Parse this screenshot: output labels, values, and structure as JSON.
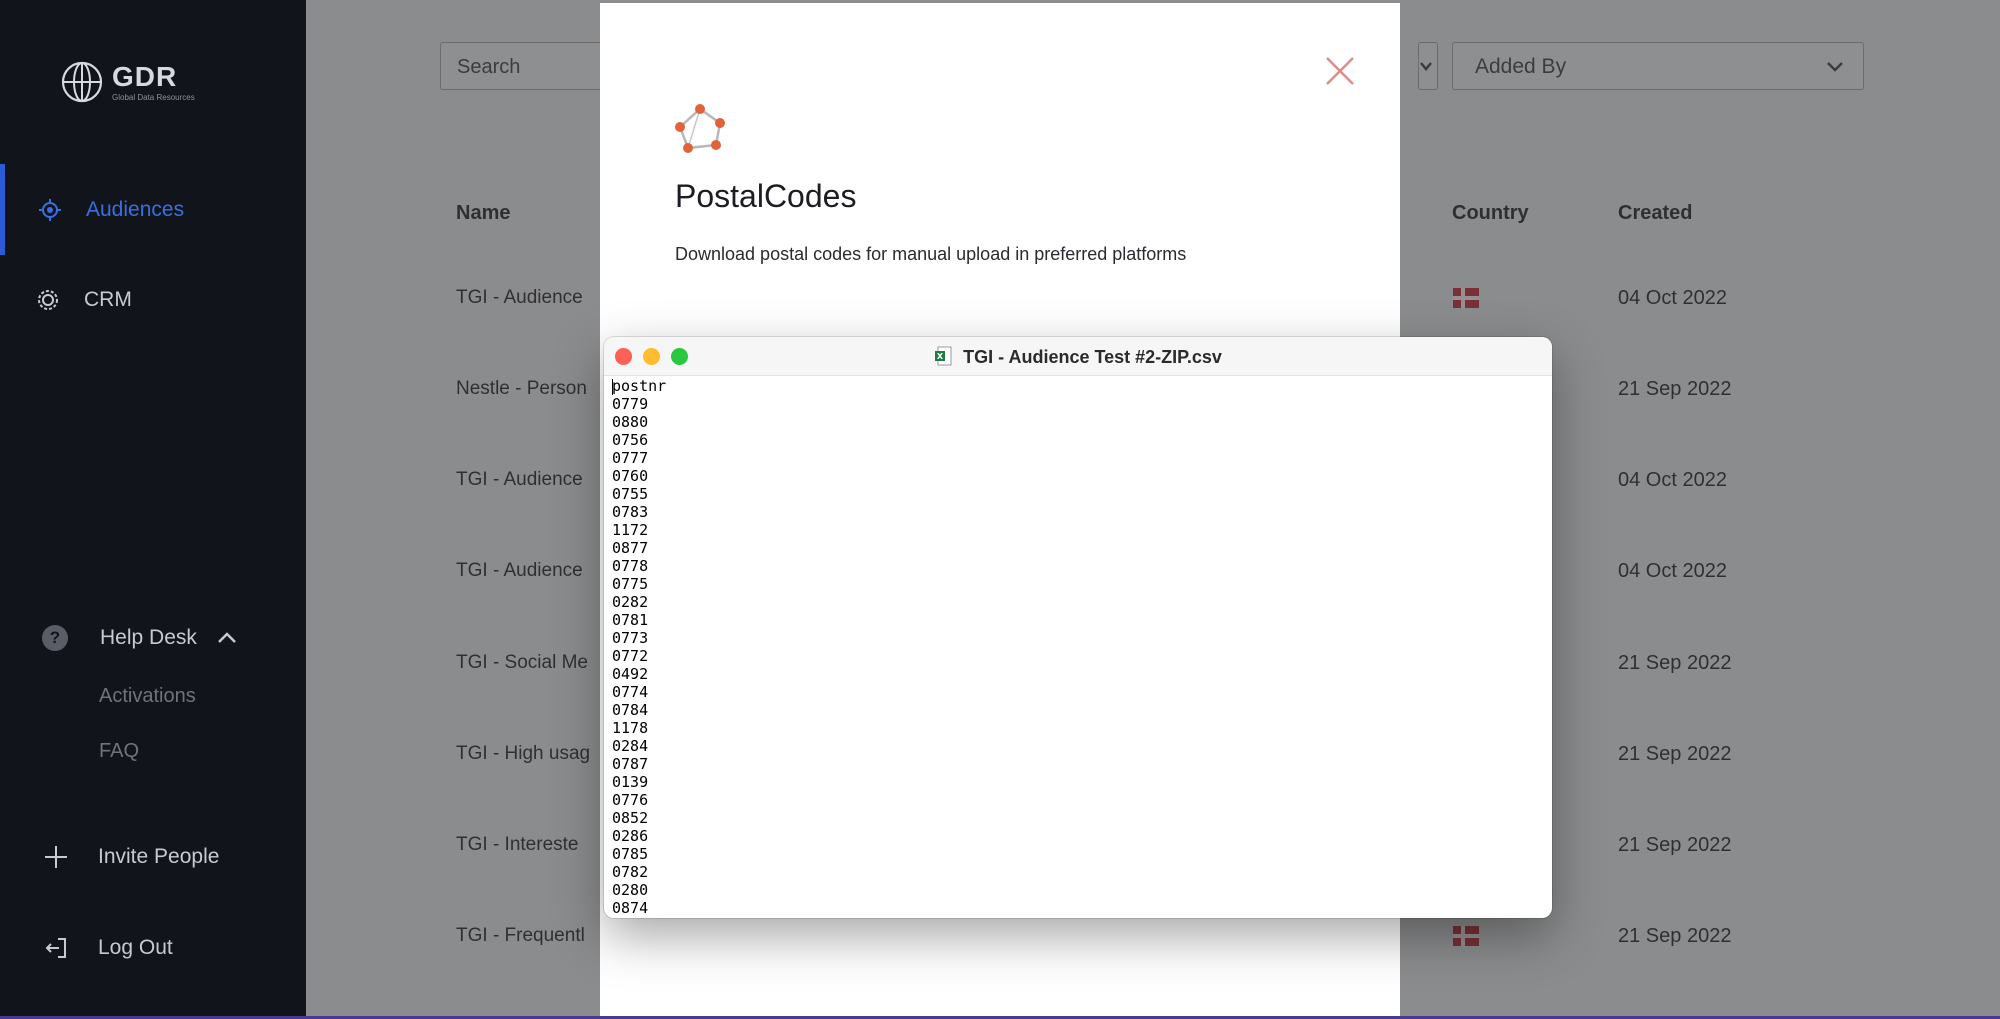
{
  "sidebar": {
    "logo_name": "GDR",
    "logo_sub": "Global Data Resources",
    "audiences": "Audiences",
    "crm": "CRM",
    "helpdesk": "Help Desk",
    "activations": "Activations",
    "faq": "FAQ",
    "invite": "Invite People",
    "logout": "Log Out"
  },
  "toolbar": {
    "search_placeholder": "Search",
    "added_by": "Added By"
  },
  "table": {
    "headers": {
      "name": "Name",
      "country": "Country",
      "created": "Created"
    },
    "rows": [
      {
        "name": "TGI - Audience",
        "date": "04 Oct 2022"
      },
      {
        "name": "Nestle - Person",
        "date": "21 Sep 2022"
      },
      {
        "name": "TGI - Audience",
        "date": "04 Oct 2022"
      },
      {
        "name": "TGI - Audience",
        "date": "04 Oct 2022"
      },
      {
        "name": "TGI - Social Me",
        "date": "21 Sep 2022"
      },
      {
        "name": "TGI - High usag",
        "date": "21 Sep 2022"
      },
      {
        "name": "TGI - Intereste",
        "date": "21 Sep 2022"
      },
      {
        "name": "TGI - Frequentl",
        "date": "21 Sep 2022"
      }
    ]
  },
  "modal": {
    "title": "PostalCodes",
    "description": "Download postal codes for manual upload in preferred platforms"
  },
  "viewer": {
    "title": "TGI - Audience Test #2-ZIP.csv",
    "lines": [
      "postnr",
      "0779",
      "0880",
      "0756",
      "0777",
      "0760",
      "0755",
      "0783",
      "1172",
      "0877",
      "0778",
      "0775",
      "0282",
      "0781",
      "0773",
      "0772",
      "0492",
      "0774",
      "0784",
      "1178",
      "0284",
      "0787",
      "0139",
      "0776",
      "0852",
      "0286",
      "0785",
      "0782",
      "0280",
      "0874"
    ]
  },
  "colors": {
    "sidebar_bg": "#11141b",
    "accent": "#3b6fe0",
    "close_x": "#e08a88",
    "logo_orange": "#e2623a"
  }
}
